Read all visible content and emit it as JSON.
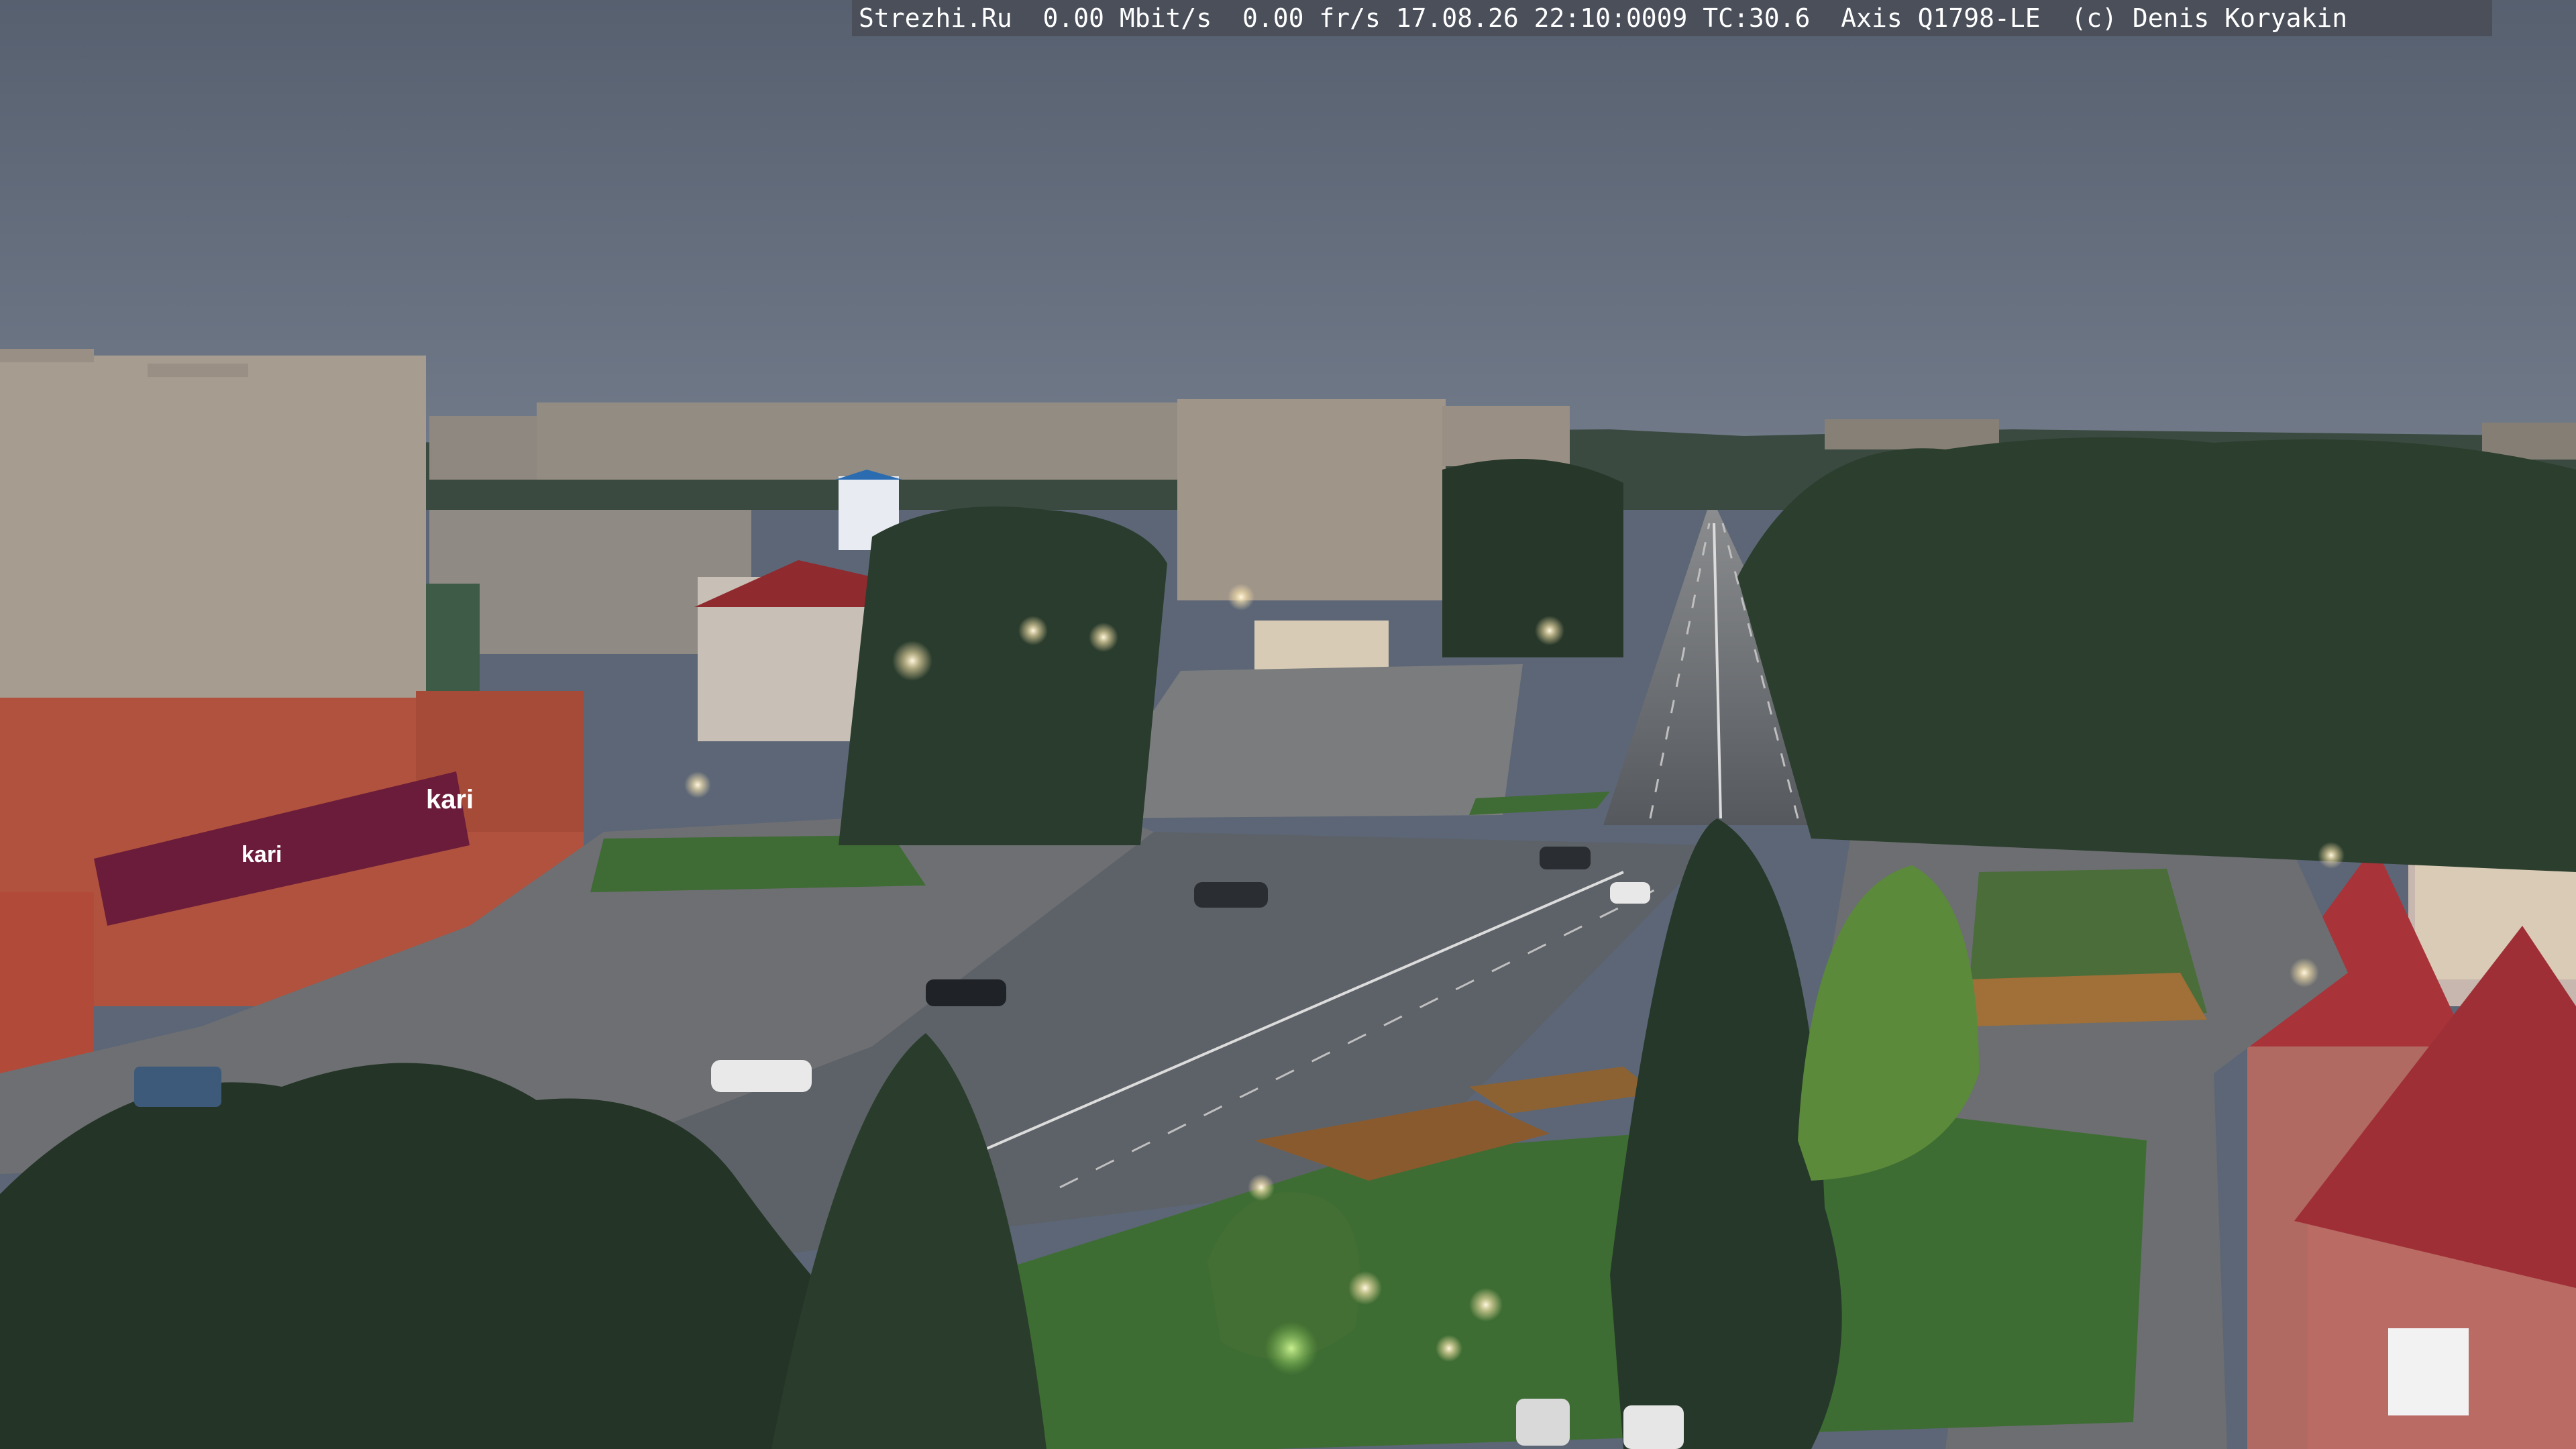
{
  "overlay": {
    "text": "Strezhi.Ru  0.00 Mbit/s  0.00 fr/s 17.08.26 22:10:0009 TC:30.6  Axis Q1798-LE  (c) Denis Koryakin"
  },
  "signage": {
    "kari_sign": "kari",
    "kari_sign_2": "kari"
  },
  "colors": {
    "sky_top": "#56606f",
    "sky_horizon": "#6d7685",
    "trees": "#25362a",
    "road": "#5d6268",
    "brick_building": "#b0523e",
    "red_roof": "#a8343a",
    "panel_building": "#a79c90",
    "lamp_glow": "#fff4d6",
    "grass": "#3f6b34"
  }
}
